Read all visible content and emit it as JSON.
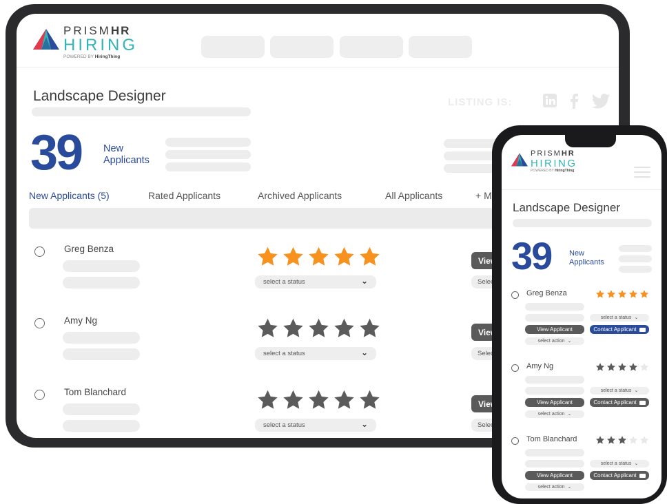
{
  "brand": {
    "line1_light": "PRISM",
    "line1_bold": "HR",
    "line2": "HIRING",
    "powered_prefix": "POWERED BY ",
    "powered_brand": "HiringThing",
    "colors": {
      "blue": "#2a4a9b",
      "teal": "#34b3b8",
      "red": "#e03a4e",
      "navy": "#1f3a8a"
    }
  },
  "job": {
    "title": "Landscape Designer"
  },
  "listing": {
    "label": "LISTING IS:",
    "social_icons": [
      "linkedin-icon",
      "facebook-icon",
      "twitter-icon"
    ]
  },
  "summary": {
    "count": "39",
    "label_line1": "New",
    "label_line2": "Applicants"
  },
  "tabs": [
    {
      "label": "New Applicants (5)",
      "active": true
    },
    {
      "label": "Rated Applicants",
      "active": false
    },
    {
      "label": "Archived Applicants",
      "active": false
    },
    {
      "label": "All Applicants",
      "active": false
    },
    {
      "label": "+ M",
      "active": false
    }
  ],
  "applicants": [
    {
      "name": "Greg Benza",
      "rating": 5,
      "rating_color": "#f7921e",
      "status_placeholder": "select a status",
      "tablet_button": "View",
      "tablet_select": "Selec",
      "mobile_rating": 5,
      "mobile_rating_color": "#f7921e"
    },
    {
      "name": "Amy Ng",
      "rating": 5,
      "rating_color": "#5b5b5b",
      "status_placeholder": "select a status",
      "tablet_button": "View",
      "tablet_select": "Selec",
      "mobile_rating": 4,
      "mobile_rating_color": "#5b5b5b"
    },
    {
      "name": "Tom Blanchard",
      "rating": 5,
      "rating_color": "#5b5b5b",
      "status_placeholder": "select a status",
      "tablet_button": "View",
      "tablet_select": "Selec",
      "mobile_rating": 3,
      "mobile_rating_color": "#5b5b5b"
    }
  ],
  "mobile": {
    "status_label": "select a status",
    "view_button": "View Applicant",
    "contact_button": "Contact Applicant",
    "action_label": "select action",
    "contact_active_color": "#2a4a9b",
    "contact_default_color": "#5a5a5a",
    "star_empty_color": "#e8e8e8"
  }
}
